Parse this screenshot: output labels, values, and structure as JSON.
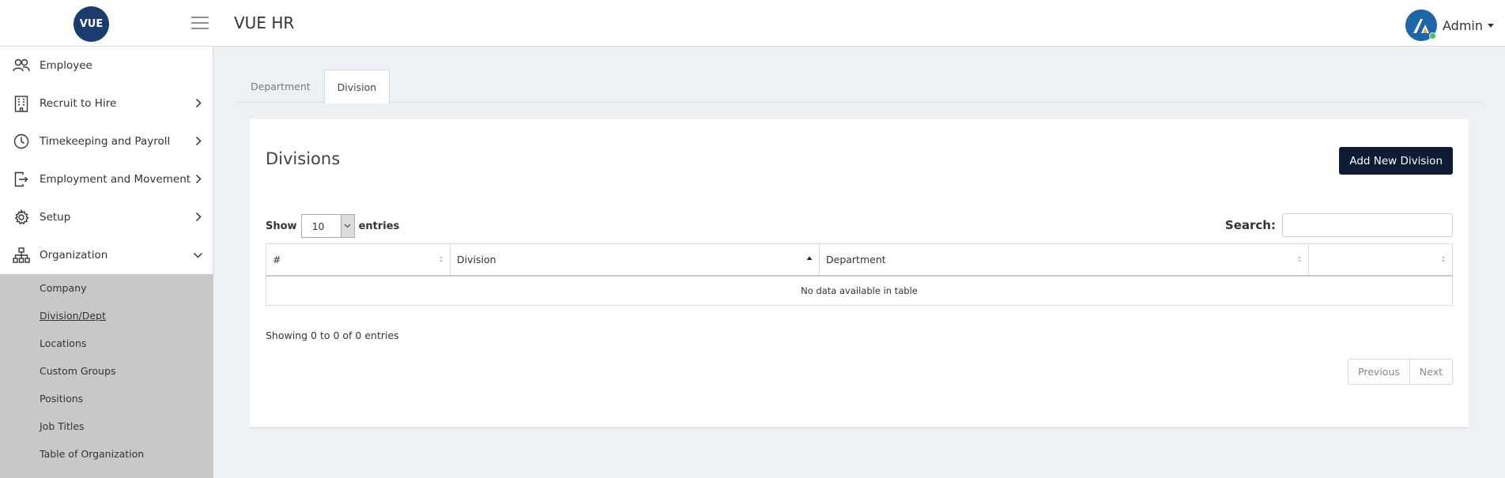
{
  "header": {
    "logo_text": "VUE",
    "app_title": "VUE HR",
    "user_name": "Admin"
  },
  "sidebar": {
    "items": [
      {
        "label": "Employee",
        "icon": "users-icon",
        "chevron": "none"
      },
      {
        "label": "Recruit to Hire",
        "icon": "building-icon",
        "chevron": "right"
      },
      {
        "label": "Timekeeping and Payroll",
        "icon": "clock-icon",
        "chevron": "right"
      },
      {
        "label": "Employment and Movement",
        "icon": "exit-icon",
        "chevron": "right"
      },
      {
        "label": "Setup",
        "icon": "gear-icon",
        "chevron": "right"
      },
      {
        "label": "Organization",
        "icon": "org-chart-icon",
        "chevron": "down"
      }
    ],
    "subitems": [
      {
        "label": "Company"
      },
      {
        "label": "Division/Dept",
        "active": true
      },
      {
        "label": "Locations"
      },
      {
        "label": "Custom Groups"
      },
      {
        "label": "Positions"
      },
      {
        "label": "Job Titles"
      },
      {
        "label": "Table of Organization"
      }
    ]
  },
  "tabs": [
    {
      "label": "Department",
      "active": false
    },
    {
      "label": "Division",
      "active": true
    }
  ],
  "card": {
    "title": "Divisions",
    "add_button": "Add New Division",
    "show_label": "Show",
    "page_length": "10",
    "entries_label": "entries",
    "search_label": "Search:",
    "search_value": "",
    "columns": [
      "#",
      "Division",
      "Department",
      ""
    ],
    "empty_message": "No data available in table",
    "info": "Showing 0 to 0 of 0 entries",
    "prev_label": "Previous",
    "next_label": "Next"
  },
  "colors": {
    "brand_navy": "#1a3c6e",
    "button_dark": "#0d1b33",
    "page_bg": "#eef1f4",
    "submenu_bg": "#c8c8c8",
    "status_online": "#3dc25a"
  }
}
